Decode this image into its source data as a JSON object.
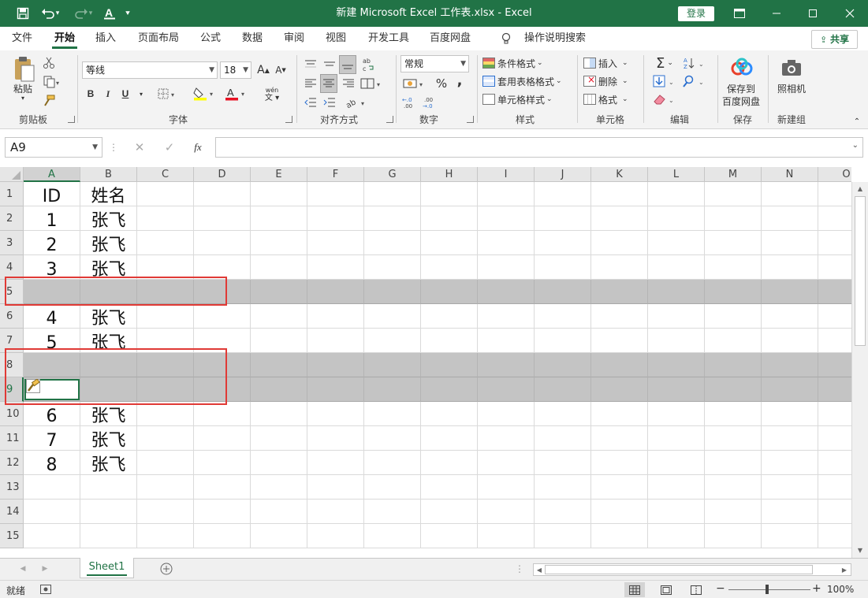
{
  "window": {
    "title": "新建 Microsoft Excel 工作表.xlsx  -  Excel",
    "login_label": "登录",
    "share_label": "共享"
  },
  "tabs": [
    {
      "label": "文件",
      "active": false
    },
    {
      "label": "开始",
      "active": true
    },
    {
      "label": "插入",
      "active": false
    },
    {
      "label": "页面布局",
      "active": false
    },
    {
      "label": "公式",
      "active": false
    },
    {
      "label": "数据",
      "active": false
    },
    {
      "label": "审阅",
      "active": false
    },
    {
      "label": "视图",
      "active": false
    },
    {
      "label": "开发工具",
      "active": false
    },
    {
      "label": "百度网盘",
      "active": false
    }
  ],
  "tell_me": "操作说明搜索",
  "ribbon": {
    "clipboard": {
      "paste_label": "粘贴",
      "group_label": "剪贴板"
    },
    "font": {
      "font_name": "等线",
      "font_size": "18",
      "bold": "B",
      "italic": "I",
      "underline": "U",
      "font_color_letter": "A",
      "group_label": "字体"
    },
    "alignment": {
      "group_label": "对齐方式"
    },
    "number": {
      "format": "常规",
      "percent": "%",
      "comma": ",",
      "group_label": "数字"
    },
    "styles": {
      "conditional": "条件格式",
      "table_format": "套用表格格式",
      "cell_styles": "单元格样式",
      "group_label": "样式"
    },
    "cells": {
      "insert": "插入",
      "delete": "删除",
      "format": "格式",
      "group_label": "单元格"
    },
    "editing": {
      "group_label": "编辑"
    },
    "save": {
      "line1": "保存到",
      "line2": "百度网盘",
      "group_label": "保存"
    },
    "new_group": {
      "camera": "照相机",
      "group_label": "新建组"
    }
  },
  "formula_bar": {
    "name_box": "A9",
    "fx_label": "fx",
    "formula": ""
  },
  "grid": {
    "columns": [
      "A",
      "B",
      "C",
      "D",
      "E",
      "F",
      "G",
      "H",
      "I",
      "J",
      "K",
      "L",
      "M",
      "N",
      "O"
    ],
    "selected_column": "A",
    "rows": [
      {
        "num": "1",
        "a": "ID",
        "b": "姓名",
        "hidden": false,
        "selected": false
      },
      {
        "num": "2",
        "a": "1",
        "b": "张飞",
        "hidden": false,
        "selected": false
      },
      {
        "num": "3",
        "a": "2",
        "b": "张飞",
        "hidden": false,
        "selected": false
      },
      {
        "num": "4",
        "a": "3",
        "b": "张飞",
        "hidden": false,
        "selected": false
      },
      {
        "num": "5",
        "a": "",
        "b": "",
        "hidden": true,
        "selected": false
      },
      {
        "num": "6",
        "a": "4",
        "b": "张飞",
        "hidden": false,
        "selected": false
      },
      {
        "num": "7",
        "a": "5",
        "b": "张飞",
        "hidden": false,
        "selected": false
      },
      {
        "num": "8",
        "a": "",
        "b": "",
        "hidden": true,
        "selected": false
      },
      {
        "num": "9",
        "a": "",
        "b": "",
        "hidden": true,
        "selected": true
      },
      {
        "num": "10",
        "a": "6",
        "b": "张飞",
        "hidden": false,
        "selected": false
      },
      {
        "num": "11",
        "a": "7",
        "b": "张飞",
        "hidden": false,
        "selected": false
      },
      {
        "num": "12",
        "a": "8",
        "b": "张飞",
        "hidden": false,
        "selected": false
      },
      {
        "num": "13",
        "a": "",
        "b": "",
        "hidden": false,
        "selected": false
      },
      {
        "num": "14",
        "a": "",
        "b": "",
        "hidden": false,
        "selected": false
      },
      {
        "num": "15",
        "a": "",
        "b": "",
        "hidden": false,
        "selected": false
      }
    ]
  },
  "sheets": [
    {
      "name": "Sheet1",
      "active": true
    }
  ],
  "status": {
    "ready": "就绪",
    "zoom": "100%",
    "zoom_minus": "−",
    "zoom_plus": "+"
  },
  "colors": {
    "accent": "#217346",
    "highlight_box": "#e03a36",
    "grey_fill": "#c4c4c4"
  }
}
